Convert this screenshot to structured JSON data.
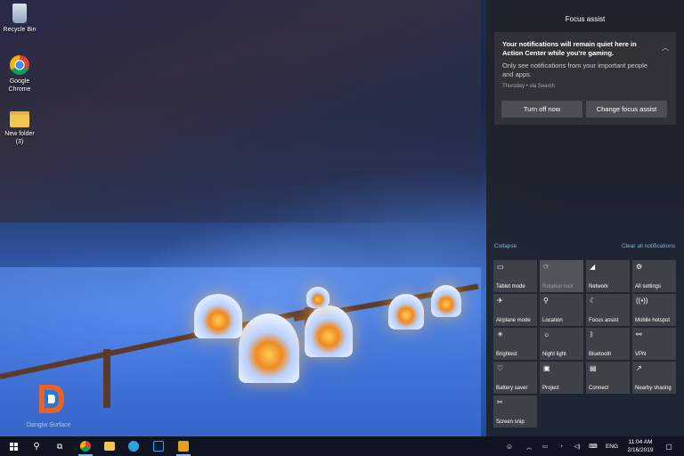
{
  "desktop": {
    "icons": [
      {
        "label": "Recycle Bin",
        "icon": "recycle-bin-icon"
      },
      {
        "label": "Google Chrome",
        "icon": "chrome-icon"
      },
      {
        "label": "New folder (3)",
        "icon": "folder-icon"
      }
    ],
    "watermark": "Dangiw Surface"
  },
  "action_center": {
    "title": "Focus assist",
    "notification": {
      "heading": "Your notifications will remain quiet here in Action Center while you're gaming.",
      "body": "Only see notifications from your important people and apps.",
      "meta": "Thursday • via Search",
      "buttons": [
        "Turn off now",
        "Change focus assist"
      ]
    },
    "collapse_label": "Collapse",
    "clear_label": "Clear all notifications",
    "quick_actions": [
      {
        "label": "Tablet mode",
        "icon": "tablet-icon",
        "enabled": true
      },
      {
        "label": "Rotation lock",
        "icon": "rotation-icon",
        "enabled": false
      },
      {
        "label": "Network",
        "icon": "network-icon",
        "enabled": true
      },
      {
        "label": "All settings",
        "icon": "gear-icon",
        "enabled": true
      },
      {
        "label": "Airplane mode",
        "icon": "airplane-icon",
        "enabled": true
      },
      {
        "label": "Location",
        "icon": "location-icon",
        "enabled": true
      },
      {
        "label": "Focus assist",
        "icon": "moon-icon",
        "enabled": true
      },
      {
        "label": "Mobile hotspot",
        "icon": "hotspot-icon",
        "enabled": true
      },
      {
        "label": "Brightest",
        "icon": "brightness-icon",
        "enabled": true
      },
      {
        "label": "Night light",
        "icon": "night-light-icon",
        "enabled": true
      },
      {
        "label": "Bluetooth",
        "icon": "bluetooth-icon",
        "enabled": true
      },
      {
        "label": "VPN",
        "icon": "vpn-icon",
        "enabled": true
      },
      {
        "label": "Battery saver",
        "icon": "battery-saver-icon",
        "enabled": true
      },
      {
        "label": "Project",
        "icon": "project-icon",
        "enabled": true
      },
      {
        "label": "Connect",
        "icon": "connect-icon",
        "enabled": true
      },
      {
        "label": "Nearby sharing",
        "icon": "share-icon",
        "enabled": true
      },
      {
        "label": "Screen snip",
        "icon": "snip-icon",
        "enabled": true
      }
    ]
  },
  "taskbar": {
    "language": "ENG",
    "time": "11:04 AM",
    "date": "2/16/2019"
  }
}
